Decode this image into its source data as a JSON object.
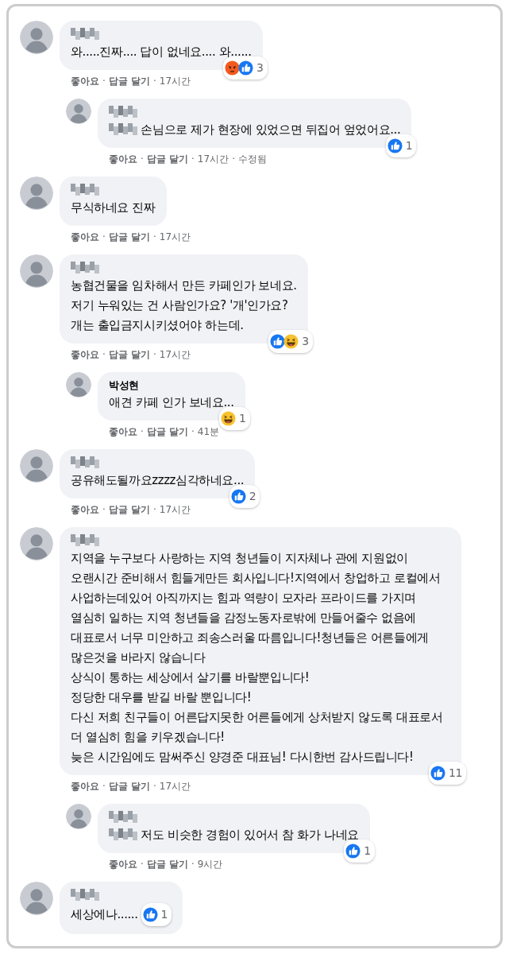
{
  "comments": [
    {
      "name_blurred": true,
      "text": "와.....진짜.... 답이 없네요.... 와......",
      "reactions": {
        "items": [
          {
            "kind": "angry"
          },
          {
            "kind": "like"
          }
        ],
        "count": "3"
      },
      "actions": [
        "좋아요",
        "·",
        "답글 달기",
        "·",
        "17시간"
      ],
      "replies": [
        {
          "name_blurred": true,
          "mention_blurred": true,
          "text": "손님으로 제가 현장에 있었으면 뒤집어 엎었어요...",
          "reactions": {
            "items": [
              {
                "kind": "like"
              }
            ],
            "count": "1"
          },
          "actions": [
            "좋아요",
            "·",
            "답글 달기",
            "·",
            "17시간",
            "·",
            "수정됨"
          ]
        }
      ]
    },
    {
      "name_blurred": true,
      "text": "무식하네요 진짜",
      "actions": [
        "좋아요",
        "·",
        "답글 달기",
        "·",
        "17시간"
      ]
    },
    {
      "name_blurred": true,
      "text": "농협건물을 임차해서 만든 카페인가 보네요.\n저기 누워있는 건 사람인가요? '개'인가요?\n개는 출입금지시키셨어야 하는데.",
      "reactions": {
        "items": [
          {
            "kind": "like"
          },
          {
            "kind": "haha"
          }
        ],
        "count": "3"
      },
      "actions": [
        "좋아요",
        "·",
        "답글 달기",
        "·",
        "17시간"
      ],
      "replies": [
        {
          "name": "박성현",
          "text": "애견 카페 인가 보네요...",
          "reactions": {
            "items": [
              {
                "kind": "haha"
              }
            ],
            "count": "1"
          },
          "actions": [
            "좋아요",
            "·",
            "답글 달기",
            "·",
            "41분"
          ]
        }
      ]
    },
    {
      "name_blurred": true,
      "text": "공유해도될까요zzzz심각하네요...",
      "reactions": {
        "items": [
          {
            "kind": "like"
          }
        ],
        "count": "2"
      },
      "actions": [
        "좋아요",
        "·",
        "답글 달기",
        "·",
        "17시간"
      ]
    },
    {
      "name_blurred": true,
      "text": "지역을 누구보다 사랑하는 지역 청년들이 지자체나 관에 지원없이 오랜시간 준비해서 힘들게만든 회사입니다!지역에서 창업하고 로컬에서 사업하는데있어 아직까지는 힘과 역량이 모자라 프라이드를 가지며 열심히 일하는 지역 청년들을 감정노동자로밖에 만들어줄수 없음에 대표로서 너무 미안하고 죄송스러울 따름입니다!청년들은 어른들에게 많은것을 바라지 않습니다\n상식이 통하는 세상에서 살기를 바랄뿐입니다!\n정당한 대우를 받길 바랄 뿐입니다!\n다신 저희 친구들이 어른답지못한 어른들에게 상처받지 않도록 대표로서 더 열심히 힘을 키우겠습니다!\n늦은 시간임에도 맘써주신 양경준 대표님! 다시한번 감사드립니다!",
      "reactions": {
        "items": [
          {
            "kind": "like"
          }
        ],
        "count": "11"
      },
      "actions": [
        "좋아요",
        "·",
        "답글 달기",
        "·",
        "17시간"
      ],
      "replies": [
        {
          "name_blurred": true,
          "mention_blurred": true,
          "text": "저도 비슷한 경험이 있어서 참 화가 나네요",
          "reactions": {
            "items": [
              {
                "kind": "like"
              }
            ],
            "count": "1"
          },
          "actions": [
            "좋아요",
            "·",
            "답글 달기",
            "·",
            "9시간"
          ]
        }
      ]
    },
    {
      "name_blurred": true,
      "text": "세상에나......",
      "reactions": {
        "items": [
          {
            "kind": "like"
          }
        ],
        "count": "1"
      },
      "inline_reactions": true
    }
  ]
}
